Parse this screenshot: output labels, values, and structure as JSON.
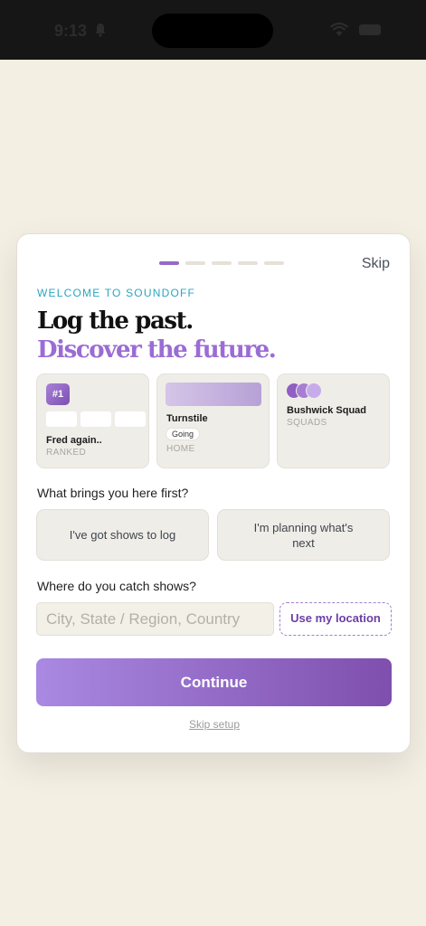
{
  "status": {
    "time": "9:13"
  },
  "onboarding": {
    "skip_label": "Skip",
    "progress_step": 1,
    "progress_total": 5,
    "eyebrow": "WELCOME TO SOUNDOFF",
    "headline_line1": "Log the past.",
    "headline_line2": "Discover the future.",
    "tiles": [
      {
        "badge": "#1",
        "title": "Fred again..",
        "caption": "RANKED"
      },
      {
        "title": "Turnstile",
        "pill": "Going",
        "caption": "HOME"
      },
      {
        "title": "Bushwick Squad",
        "caption": "SQUADS"
      }
    ],
    "question1": "What brings you here first?",
    "choices": [
      {
        "label": "I've got shows to log"
      },
      {
        "label": "I'm planning what's next"
      }
    ],
    "question2": "Where do you catch shows?",
    "location_placeholder": "City, State / Region, Country",
    "location_value": "",
    "use_location_label": "Use my location",
    "continue_label": "Continue",
    "skip_setup_label": "Skip setup"
  },
  "colors": {
    "accent": "#9b6cd4",
    "eyebrow": "#2aa5c1",
    "background": "#f4efe3"
  },
  "icons": {
    "status_bell": "bell-icon",
    "status_wifi": "wifi-icon",
    "status_battery": "battery-icon"
  }
}
